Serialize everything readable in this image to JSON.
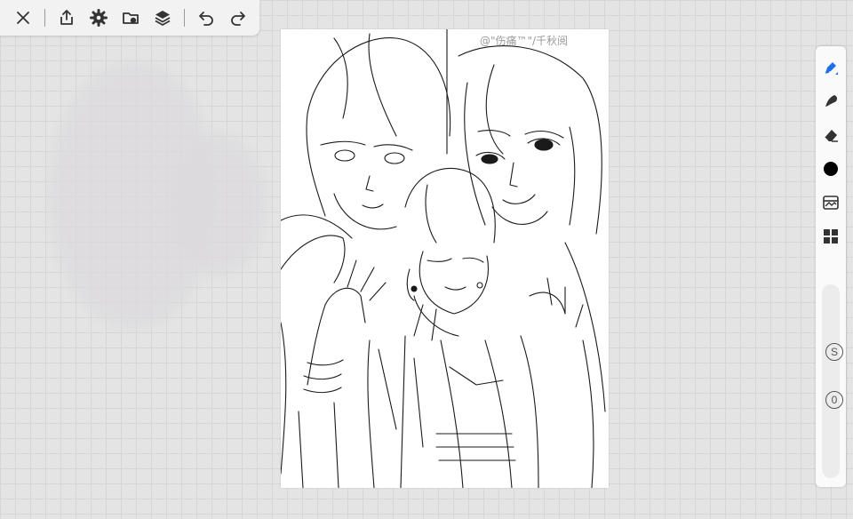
{
  "toolbar": {
    "buttons": [
      {
        "name": "close-icon"
      },
      {
        "name": "share-icon"
      },
      {
        "name": "gear-icon"
      },
      {
        "name": "import-icon"
      },
      {
        "name": "layers-icon"
      },
      {
        "name": "undo-icon"
      },
      {
        "name": "redo-icon"
      }
    ]
  },
  "canvas": {
    "watermark": "@\"伤痛™\"/千秋阅"
  },
  "right_panel": {
    "tools": [
      "pen-icon",
      "smudge-icon",
      "eraser-icon",
      "color-swatch",
      "gallery-icon",
      "grid-icon"
    ],
    "size_label": "S",
    "opacity_label": "0",
    "active_color": "#000000",
    "accent": "#1e6fe8"
  }
}
